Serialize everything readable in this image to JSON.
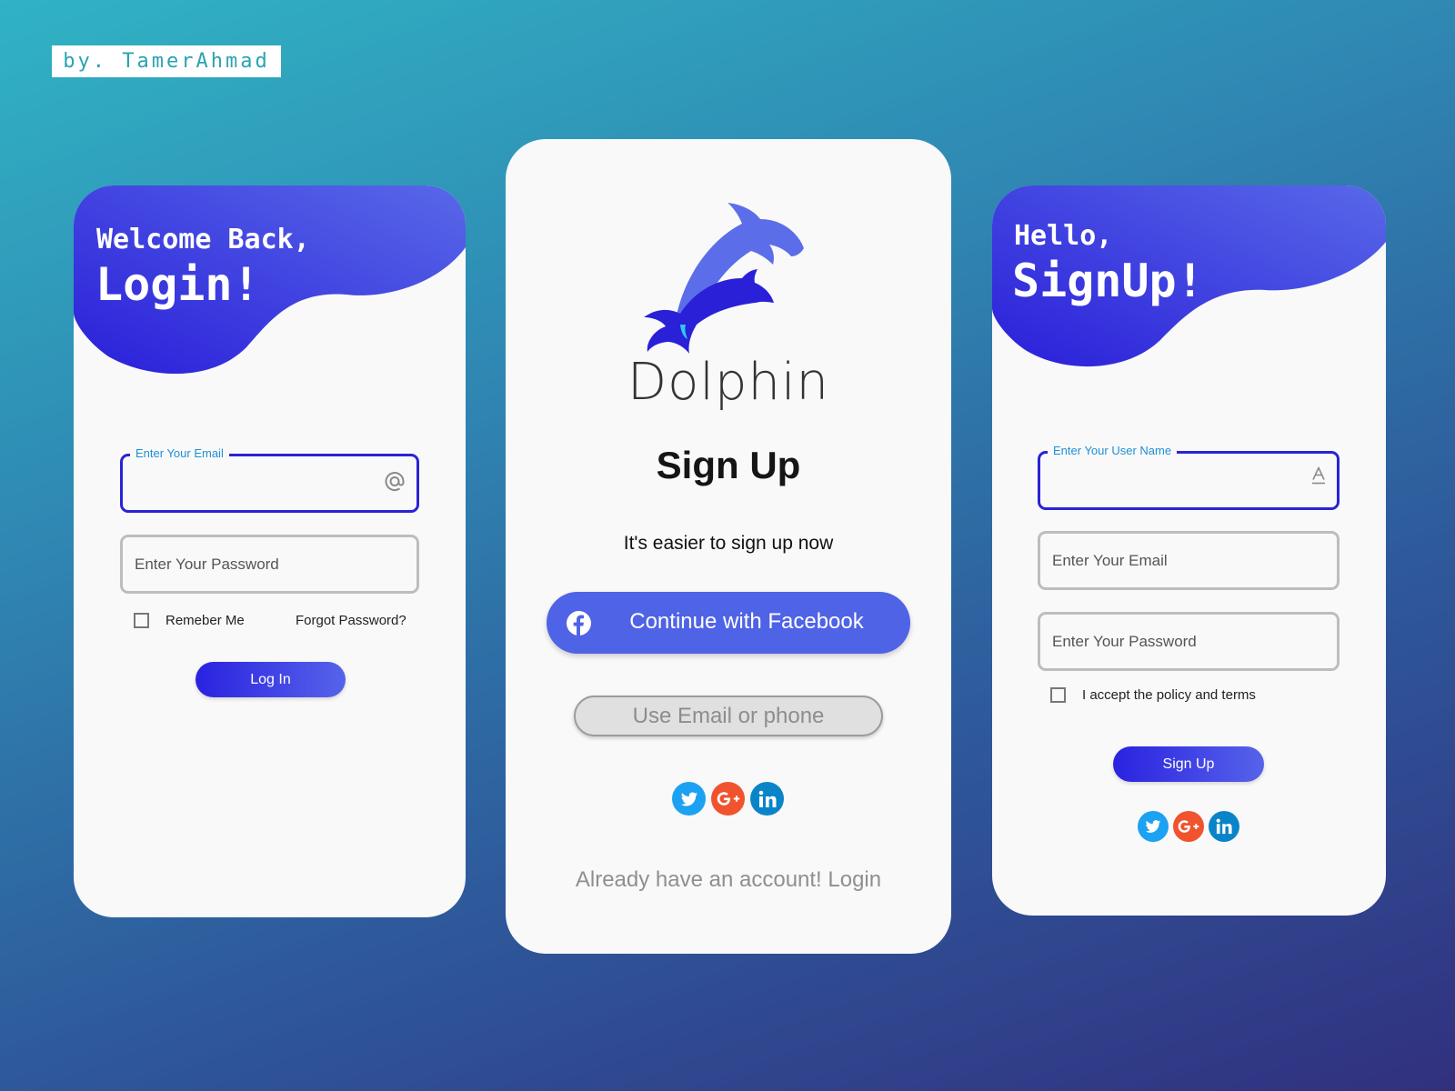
{
  "credit": "by. TamerAhmad",
  "colors": {
    "accent": "#2b22d6",
    "accent_light": "#5663ea",
    "field_label": "#1f8fd6"
  },
  "login": {
    "greeting": "Welcome Back,",
    "title": "Login!",
    "email_label": "Enter Your Email",
    "email_icon": "at-icon",
    "password_placeholder": "Enter Your Password",
    "remember_label": "Remeber Me",
    "forgot_link": "Forgot Password?",
    "login_button": "Log In"
  },
  "signup_center": {
    "brand": "Dolphin",
    "logo_icon": "dolphin-logo-icon",
    "title": "Sign Up",
    "subtitle": "It's easier to sign up now",
    "facebook_button": "Continue with Facebook",
    "email_phone_button": "Use Email or phone",
    "socials": [
      "twitter-icon",
      "google-plus-icon",
      "linkedin-icon"
    ],
    "login_link": "Already have an account! Login"
  },
  "signup_right": {
    "greeting": "Hello,",
    "title": "SignUp!",
    "username_label": "Enter Your User Name",
    "username_icon": "text-a-icon",
    "email_placeholder": "Enter Your Email",
    "password_placeholder": "Enter Your Password",
    "terms_label": "I accept the policy and terms",
    "signup_button": "Sign Up",
    "socials": [
      "twitter-icon",
      "google-plus-icon",
      "linkedin-icon"
    ]
  }
}
